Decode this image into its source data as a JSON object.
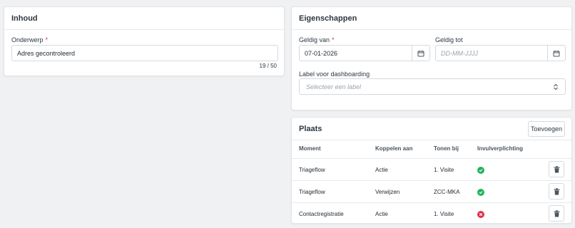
{
  "inhoud": {
    "title": "Inhoud",
    "onderwerp_label": "Onderwerp",
    "required_mark": "*",
    "onderwerp_value": "Adres gecontroleerd",
    "counter": "19 / 50"
  },
  "eigenschappen": {
    "title": "Eigenschappen",
    "geldig_van_label": "Geldig van",
    "geldig_van_value": "07-01-2026",
    "geldig_tot_label": "Geldig tot",
    "geldig_tot_placeholder": "DD-MM-JJJJ",
    "label_dash_label": "Label voor dashboarding",
    "label_dash_placeholder": "Selecteer een label"
  },
  "plaats": {
    "title": "Plaats",
    "add_button": "Toevoegen",
    "columns": [
      "Moment",
      "Koppelen aan",
      "Tonen bij",
      "Invulverplichting"
    ],
    "rows": [
      {
        "moment": "Triageflow",
        "koppelen": "Actie",
        "tonen": "1. Visite",
        "verplicht": true
      },
      {
        "moment": "Triageflow",
        "koppelen": "Verwijzen",
        "tonen": "ZCC-MKA",
        "verplicht": true
      },
      {
        "moment": "Contactregistratie",
        "koppelen": "Actie",
        "tonen": "1. Visite",
        "verplicht": false
      }
    ]
  },
  "colors": {
    "success": "#22b35e",
    "error": "#e0334a",
    "required": "#d92d3a"
  }
}
